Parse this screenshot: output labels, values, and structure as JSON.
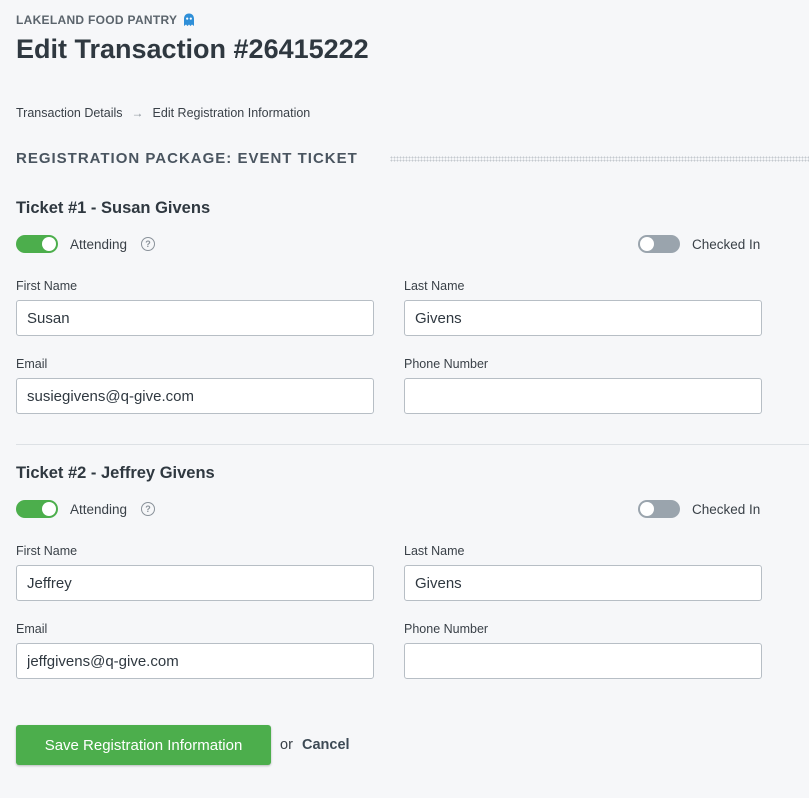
{
  "header": {
    "org_name": "LAKELAND FOOD PANTRY",
    "org_icon": "ghost-icon",
    "title": "Edit Transaction #26415222"
  },
  "breadcrumb": {
    "items": [
      "Transaction Details",
      "Edit Registration Information"
    ],
    "separator": "→"
  },
  "section": {
    "title": "REGISTRATION PACKAGE: EVENT TICKET"
  },
  "tickets": [
    {
      "title": "Ticket #1 - Susan Givens",
      "attending_label": "Attending",
      "attending": true,
      "checked_in_label": "Checked In",
      "checked_in": false,
      "first_name_label": "First Name",
      "first_name": "Susan",
      "last_name_label": "Last Name",
      "last_name": "Givens",
      "email_label": "Email",
      "email": "susiegivens@q-give.com",
      "phone_label": "Phone Number",
      "phone": ""
    },
    {
      "title": "Ticket #2 - Jeffrey Givens",
      "attending_label": "Attending",
      "attending": true,
      "checked_in_label": "Checked In",
      "checked_in": false,
      "first_name_label": "First Name",
      "first_name": "Jeffrey",
      "last_name_label": "Last Name",
      "last_name": "Givens",
      "email_label": "Email",
      "email": "jeffgivens@q-give.com",
      "phone_label": "Phone Number",
      "phone": ""
    }
  ],
  "actions": {
    "save_label": "Save Registration Information",
    "or_label": "or",
    "cancel_label": "Cancel"
  },
  "colors": {
    "accent_green": "#4cae4c",
    "toggle_off": "#9aa4ad",
    "icon_blue": "#2f8fd8"
  }
}
